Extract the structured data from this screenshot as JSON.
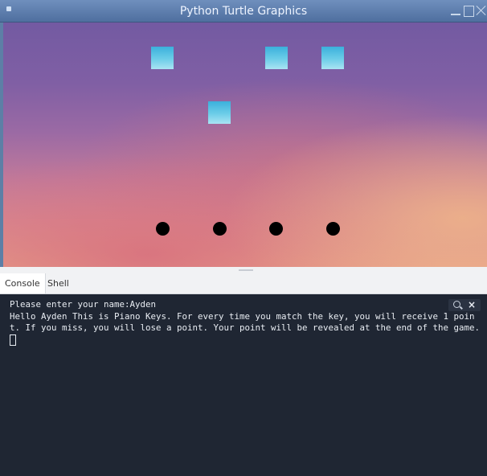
{
  "window": {
    "title": "Python Turtle Graphics",
    "canvas_keys": 4,
    "canvas_balls": 4
  },
  "tabs": [
    {
      "label": "Console",
      "active": true
    },
    {
      "label": "Shell",
      "active": false
    }
  ],
  "console": {
    "lines": [
      "Please enter your name:Ayden",
      "Hello Ayden This is Piano Keys. For every time you match the key, you will receive 1 point. If you miss, you will lose a point. Your point will be revealed at the end of the game."
    ]
  },
  "icons": {
    "search": "search-icon",
    "close": "close-icon"
  },
  "colors": {
    "key": "#5cc4e6",
    "ball": "#000000",
    "console_bg": "#1f2633",
    "title_bar": "#5f80b0"
  }
}
